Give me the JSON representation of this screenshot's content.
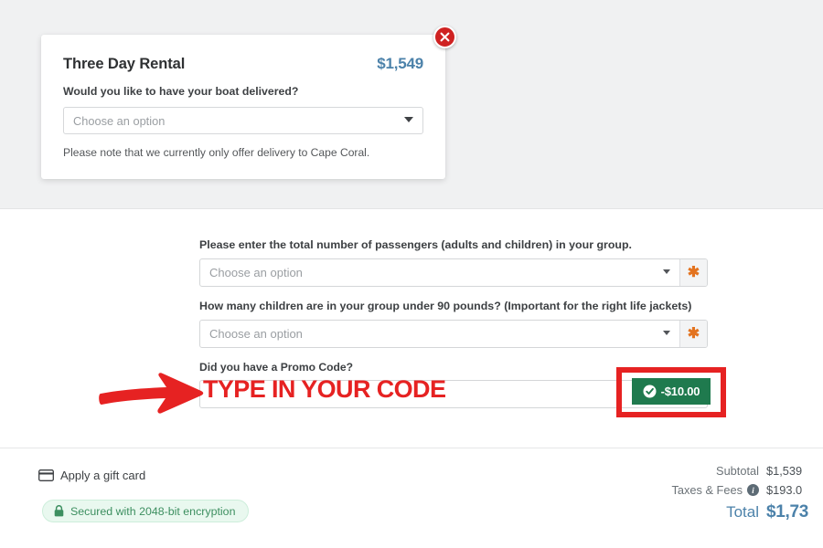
{
  "colors": {
    "accent_blue": "#4c82aa",
    "annotation_red": "#e62222",
    "badge_green": "#1f7a4e",
    "required_orange": "#e3731f",
    "secure_green": "#3d8f60",
    "close_red": "#cf2222",
    "band_gray": "#f0f1f2"
  },
  "rental_card": {
    "title": "Three Day Rental",
    "price": "$1,549",
    "question": "Would you like to have your boat delivered?",
    "select_placeholder": "Choose an option",
    "note": "Please note that we currently only offer delivery to Cape Coral.",
    "close_icon": "close-circle-icon",
    "caret_icon": "chevron-down-icon"
  },
  "form": {
    "fields": [
      {
        "label": "Please enter the total number of passengers (adults and children) in your group.",
        "placeholder": "Choose an option",
        "required_marker": "✱",
        "caret_icon": "chevron-down-icon"
      },
      {
        "label": "How many children are in your group under 90 pounds? (Important for the right life jackets)",
        "placeholder": "Choose an option",
        "required_marker": "✱",
        "caret_icon": "chevron-down-icon"
      }
    ],
    "promo": {
      "label": "Did you have a Promo Code?",
      "value": "",
      "placeholder": "",
      "discount_badge": "-$10.00",
      "badge_icon": "check-circle-icon"
    }
  },
  "annotations": {
    "typed_hint": "TYPE IN YOUR CODE",
    "arrow_icon": "arrow-right-icon",
    "highlight_box": "rectangle-highlight"
  },
  "footer": {
    "gift_card_label": "Apply a gift card",
    "gift_card_icon": "credit-card-icon",
    "security_label": "Secured with 2048-bit encryption",
    "security_icon": "lock-icon",
    "totals": [
      {
        "label": "Subtotal",
        "value": "$1,539",
        "info": false
      },
      {
        "label": "Taxes & Fees",
        "value": "$193.0",
        "info": true,
        "info_icon": "info-icon"
      }
    ],
    "total": {
      "label": "Total",
      "value": "$1,73"
    }
  }
}
